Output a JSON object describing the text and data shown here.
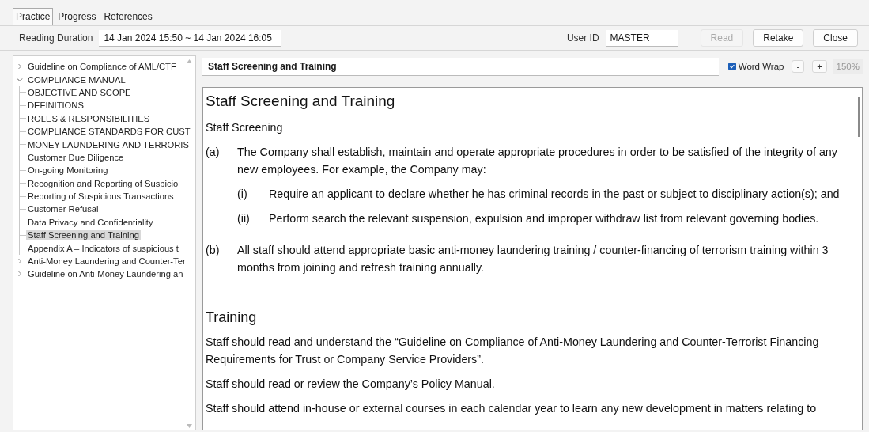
{
  "tabs": [
    {
      "label": "Practice",
      "selected": true
    },
    {
      "label": "Progress",
      "selected": false
    },
    {
      "label": "References",
      "selected": false
    }
  ],
  "reading_duration": {
    "label": "Reading Duration",
    "value": "14 Jan 2024 15:50 ~ 14 Jan 2024 16:05"
  },
  "user_id": {
    "label": "User ID",
    "value": "MASTER"
  },
  "buttons": [
    {
      "label": "Read",
      "disabled": true
    },
    {
      "label": "Retake",
      "disabled": false
    },
    {
      "label": "Close",
      "disabled": false
    }
  ],
  "tree": [
    {
      "label": "Guideline on Compliance of AML/CTF",
      "expanded": false,
      "selected": false
    },
    {
      "label": "COMPLIANCE MANUAL",
      "expanded": true,
      "selected": false,
      "children": [
        {
          "label": "OBJECTIVE AND SCOPE",
          "selected": false
        },
        {
          "label": "DEFINITIONS",
          "selected": false
        },
        {
          "label": "ROLES & RESPONSIBILITIES",
          "selected": false
        },
        {
          "label": "COMPLIANCE STANDARDS FOR CUST",
          "selected": false
        },
        {
          "label": "MONEY-LAUNDERING AND TERRORIS",
          "selected": false
        },
        {
          "label": "Customer Due Diligence",
          "selected": false
        },
        {
          "label": "On-going Monitoring",
          "selected": false
        },
        {
          "label": "Recognition and Reporting of Suspicio",
          "selected": false
        },
        {
          "label": "Reporting of Suspicious Transactions",
          "selected": false
        },
        {
          "label": "Customer Refusal",
          "selected": false
        },
        {
          "label": "Data Privacy and Confidentiality",
          "selected": false
        },
        {
          "label": "Staff Screening and Training",
          "selected": true
        },
        {
          "label": "Appendix A – Indicators of suspicious t",
          "selected": false
        }
      ]
    },
    {
      "label": "Anti-Money Laundering and Counter-Ter",
      "expanded": false,
      "selected": false
    },
    {
      "label": "Guideline on Anti-Money Laundering an",
      "expanded": false,
      "selected": false
    }
  ],
  "section_title": "Staff Screening and Training",
  "word_wrap": {
    "label": "Word Wrap",
    "checked": true
  },
  "zoom": {
    "minus": "-",
    "plus": "+",
    "value": "150%"
  },
  "document": [
    {
      "kind": "heading",
      "text": "Staff Screening and Training"
    },
    {
      "kind": "paragraph",
      "text": "Staff Screening"
    },
    {
      "kind": "item",
      "marker": "(a)",
      "text": "The Company shall establish, maintain and operate appropriate procedures in order to be satisfied of the integrity of any new employees.  For example, the Company may:",
      "children": [
        {
          "marker": "(i)",
          "text": "Require an applicant to declare whether he has criminal records in the past or subject to disciplinary action(s); and"
        },
        {
          "marker": "(ii)",
          "text": "Perform search the relevant suspension, expulsion and improper withdraw list from relevant governing bodies."
        }
      ]
    },
    {
      "kind": "item",
      "marker": "(b)",
      "text": "All staff should attend appropriate basic anti-money laundering training / counter-financing of terrorism training within 3 months from joining and refresh training annually."
    },
    {
      "kind": "section",
      "text": "Training"
    },
    {
      "kind": "paragraph",
      "text": "Staff should read and understand the “Guideline on Compliance of Anti-Money Laundering and Counter-Terrorist Financing Requirements for Trust or Company Service Providers”."
    },
    {
      "kind": "paragraph",
      "text": "Staff should read or review the Company’s Policy Manual."
    },
    {
      "kind": "paragraph",
      "text": "Staff should attend in-house or external courses in each calendar year to learn any new development in matters relating to"
    }
  ]
}
